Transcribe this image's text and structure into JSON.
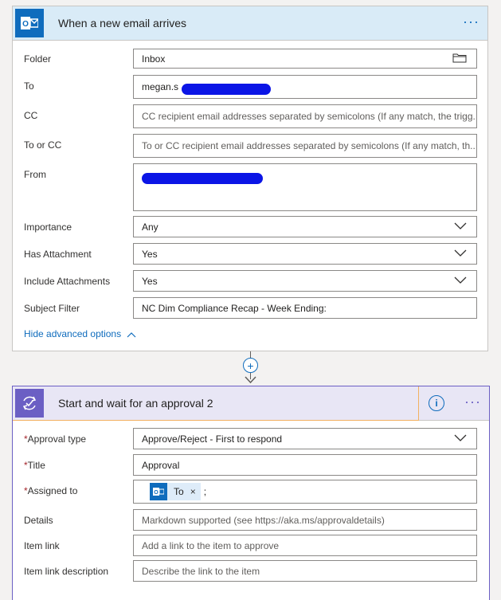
{
  "trigger": {
    "title": "When a new email arrives",
    "icon": "outlook-icon",
    "fields": {
      "folder": {
        "label": "Folder",
        "value": "Inbox"
      },
      "to": {
        "label": "To",
        "value": "megan.s"
      },
      "cc": {
        "label": "CC",
        "placeholder": "CC recipient email addresses separated by semicolons (If any match, the trigg..."
      },
      "to_or_cc": {
        "label": "To or CC",
        "placeholder": "To or CC recipient email addresses separated by semicolons (If any match, th..."
      },
      "from": {
        "label": "From",
        "value": ""
      },
      "importance": {
        "label": "Importance",
        "value": "Any"
      },
      "has_attachment": {
        "label": "Has Attachment",
        "value": "Yes"
      },
      "include_attachments": {
        "label": "Include Attachments",
        "value": "Yes"
      },
      "subject_filter": {
        "label": "Subject Filter",
        "value": "NC Dim Compliance Recap - Week Ending:"
      }
    },
    "advanced_link": "Hide advanced options"
  },
  "connector": {
    "plus_label": "+"
  },
  "approval": {
    "title": "Start and wait for an approval 2",
    "info_label": "i",
    "fields": {
      "approval_type": {
        "required": "*",
        "label": "Approval type",
        "value": "Approve/Reject - First to respond"
      },
      "title": {
        "required": "*",
        "label": "Title",
        "value": "Approval"
      },
      "assigned_to": {
        "required": "*",
        "label": "Assigned to",
        "chip": "To",
        "chip_close": "×",
        "suffix": ";"
      },
      "details": {
        "label": "Details",
        "placeholder": "Markdown supported (see https://aka.ms/approvaldetails)"
      },
      "item_link": {
        "label": "Item link",
        "placeholder": "Add a link to the item to approve"
      },
      "item_link_description": {
        "label": "Item link description",
        "placeholder": "Describe the link to the item"
      }
    }
  },
  "dots_label": "···",
  "colors": {
    "outlook_blue": "#0f6cbd",
    "approval_purple": "#6b5fc4",
    "redaction": "#0b15e6",
    "required": "#a4262c"
  }
}
